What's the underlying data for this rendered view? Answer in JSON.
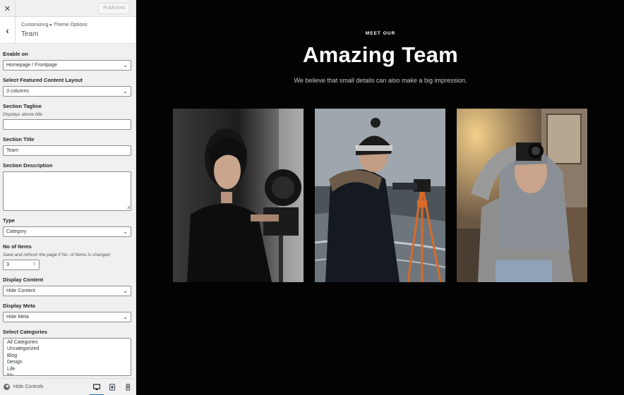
{
  "topbar": {
    "close_icon": "close-icon",
    "publish_label": "Published"
  },
  "section": {
    "breadcrumb": "Customizing ▸ Theme Options",
    "title": "Team"
  },
  "controls": {
    "enable_on": {
      "label": "Enable on",
      "value": "Homepage / Frontpage"
    },
    "layout": {
      "label": "Select Featured Content Layout",
      "value": "3 columns"
    },
    "tagline": {
      "label": "Section Tagline",
      "description": "Displays above title",
      "value": ""
    },
    "section_title": {
      "label": "Section Title",
      "value": "Team"
    },
    "section_description": {
      "label": "Section Description",
      "value": ""
    },
    "type": {
      "label": "Type",
      "value": "Category"
    },
    "items": {
      "label": "No of Items",
      "description": "Save and refresh the page if No. of Items is changed",
      "value": "3"
    },
    "display_content": {
      "label": "Display Content",
      "value": "Hide Content"
    },
    "display_meta": {
      "label": "Display Meta",
      "value": "Hide Meta"
    },
    "categories": {
      "label": "Select Categories",
      "options": [
        "All Categories",
        "Uncategorized",
        "Blog",
        "Design",
        "Life",
        "No"
      ]
    }
  },
  "footer": {
    "hide_controls_label": "Hide Controls",
    "devices": [
      "desktop-icon",
      "tablet-icon",
      "mobile-icon"
    ]
  },
  "preview": {
    "eyebrow": "MEET OUR",
    "headline": "Amazing Team",
    "subline": "We believe that small details can also make a big impression."
  },
  "colors": {
    "accent": "#2271b1",
    "panel": "#f0f0f1",
    "preview_bg": "#030303"
  }
}
